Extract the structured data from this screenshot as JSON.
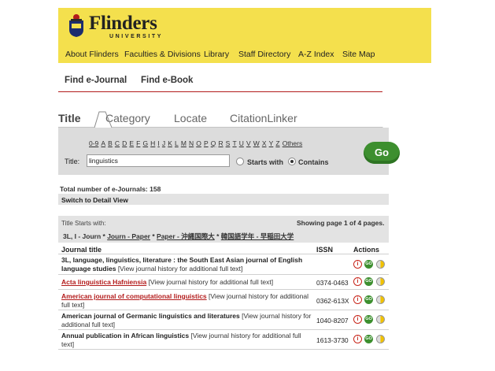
{
  "logo": {
    "name": "Flinders",
    "sub": "UNIVERSITY"
  },
  "nav": [
    "About Flinders",
    "Faculties & Divisions",
    "Library",
    "Staff Directory",
    "A-Z Index",
    "Site Map"
  ],
  "subnav": [
    "Find e-Journal",
    "Find e-Book"
  ],
  "tabs": [
    "Title",
    "Category",
    "Locate",
    "CitationLinker"
  ],
  "alphabet": [
    "0-9",
    "A",
    "B",
    "C",
    "D",
    "E",
    "F",
    "G",
    "H",
    "I",
    "J",
    "K",
    "L",
    "M",
    "N",
    "O",
    "P",
    "Q",
    "R",
    "S",
    "T",
    "U",
    "V",
    "W",
    "X",
    "Y",
    "Z",
    "Others"
  ],
  "search": {
    "label": "Title:",
    "value": "linguistics",
    "starts_with": "Starts with",
    "contains": "Contains",
    "selected": "Contains"
  },
  "go_label": "Go",
  "total": "Total number of e-Journals: 158",
  "switch_view": "Switch to Detail View",
  "results": {
    "starts_label": "Title Starts with:",
    "paging": "Showing page 1 of 4 pages.",
    "ranges": {
      "current": "3L, I - Journ",
      "links": [
        "Journ - Paper",
        "Paper - 沖縄国際大",
        "韓国語学年 - 早稲田大学"
      ]
    },
    "headers": {
      "title": "Journal title",
      "issn": "ISSN",
      "actions": "Actions"
    },
    "history_text": "[View journal history for additional full text]",
    "rows": [
      {
        "name": "3L, language, linguistics, literature : the South East Asian journal of English language studies",
        "issn": "",
        "red": false
      },
      {
        "name": "Acta linguistica Hafniensia",
        "issn": "0374-0463",
        "red": true
      },
      {
        "name": "American journal of computational linguistics",
        "issn": "0362-613X",
        "red": true
      },
      {
        "name": "American journal of Germanic linguistics and literatures",
        "issn": "1040-8207",
        "red": false
      },
      {
        "name": "Annual publication in African linguistics",
        "issn": "1613-3730",
        "red": false
      }
    ]
  },
  "colors": {
    "banner": "#f4e04d",
    "accent_red": "#b31b1b",
    "go_green": "#3d8f2f"
  }
}
